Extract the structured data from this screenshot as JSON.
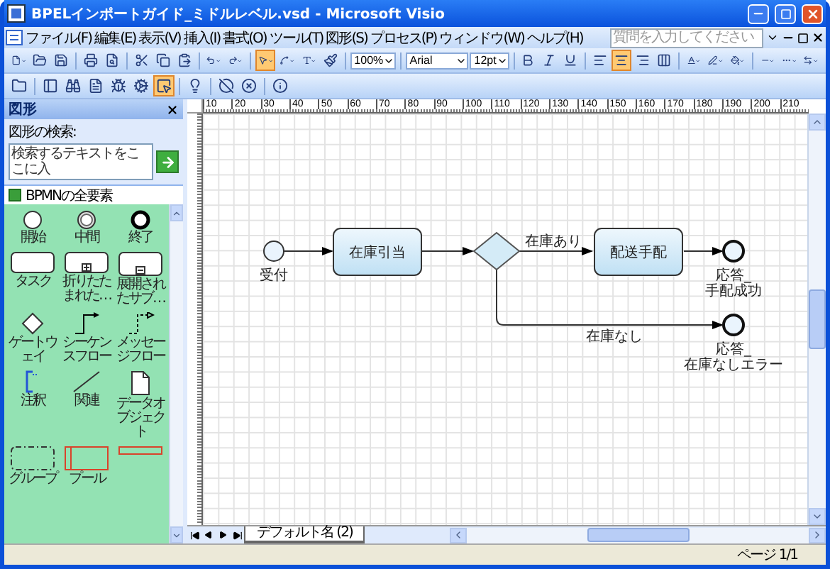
{
  "window": {
    "title": "BPELインポートガイド_ミドルレベル.vsd - Microsoft Visio"
  },
  "menu": [
    "ファイル(F)",
    "編集(E)",
    "表示(V)",
    "挿入(I)",
    "書式(O)",
    "ツール(T)",
    "図形(S)",
    "プロセス(P)",
    "ウィンドウ(W)",
    "ヘルプ(H)"
  ],
  "help_search": {
    "placeholder": "質問を入力してください"
  },
  "toolbars": [
    {
      "items": [
        {
          "kind": "new",
          "pressed": false
        },
        {
          "kind": "open",
          "pressed": false
        },
        {
          "kind": "save",
          "pressed": false
        },
        {
          "kind": "separator"
        },
        {
          "kind": "print",
          "pressed": false
        },
        {
          "kind": "preview",
          "pressed": false
        },
        {
          "kind": "separator"
        },
        {
          "kind": "cut",
          "pressed": false
        },
        {
          "kind": "copy",
          "pressed": false
        },
        {
          "kind": "paste",
          "pressed": false
        },
        {
          "kind": "separator"
        },
        {
          "kind": "undo",
          "pressed": false
        },
        {
          "kind": "redo",
          "pressed": false
        },
        {
          "kind": "separator"
        },
        {
          "kind": "pointer",
          "pressed": true
        },
        {
          "kind": "connector",
          "pressed": false
        },
        {
          "kind": "text",
          "pressed": false
        },
        {
          "kind": "format-painter",
          "pressed": false
        },
        {
          "kind": "separator"
        },
        {
          "kind": "zoom",
          "value": "100%"
        },
        {
          "kind": "separator"
        },
        {
          "kind": "font",
          "value": "Arial"
        },
        {
          "kind": "font-size",
          "value": "12pt"
        },
        {
          "kind": "separator"
        },
        {
          "kind": "bold",
          "pressed": false
        },
        {
          "kind": "italic",
          "pressed": false
        },
        {
          "kind": "underline",
          "pressed": false
        },
        {
          "kind": "separator"
        },
        {
          "kind": "align-left",
          "pressed": false
        },
        {
          "kind": "align-center",
          "pressed": true
        },
        {
          "kind": "align-right",
          "pressed": false
        },
        {
          "kind": "distribute",
          "pressed": false
        },
        {
          "kind": "separator"
        },
        {
          "kind": "font-color",
          "pressed": false
        },
        {
          "kind": "line-color",
          "pressed": false
        },
        {
          "kind": "fill-color",
          "pressed": false
        },
        {
          "kind": "separator"
        },
        {
          "kind": "line-weight",
          "pressed": false
        },
        {
          "kind": "line-pattern",
          "pressed": false
        },
        {
          "kind": "line-ends",
          "pressed": false
        }
      ]
    },
    {
      "items": [
        {
          "kind": "shapes",
          "pressed": false
        },
        {
          "kind": "separator"
        },
        {
          "kind": "layers",
          "pressed": false
        },
        {
          "kind": "find",
          "pressed": false
        },
        {
          "kind": "document",
          "pressed": false
        },
        {
          "kind": "debug",
          "pressed": false
        },
        {
          "kind": "add-ons",
          "pressed": false
        },
        {
          "kind": "select",
          "pressed": true
        },
        {
          "kind": "separator"
        },
        {
          "kind": "help",
          "pressed": false
        },
        {
          "kind": "separator"
        },
        {
          "kind": "stop",
          "pressed": false
        },
        {
          "kind": "cancel",
          "pressed": false
        },
        {
          "kind": "separator"
        },
        {
          "kind": "info",
          "pressed": false
        }
      ]
    }
  ],
  "shapes_panel": {
    "title": "図形",
    "search_label": "図形の検索:",
    "search_placeholder": "検索するテキストをここに入",
    "stencil": "BPMNの全要素",
    "items": [
      {
        "kind": "start-event",
        "label": "開始"
      },
      {
        "kind": "intermediate-event",
        "label": "中間"
      },
      {
        "kind": "end-event",
        "label": "終了"
      },
      {
        "kind": "task",
        "label": "タスク"
      },
      {
        "kind": "collapsed-subprocess",
        "label": "折りたたまれた…"
      },
      {
        "kind": "expanded-subprocess",
        "label": "展開されたサブ…"
      },
      {
        "kind": "gateway",
        "label": "ゲートウェイ"
      },
      {
        "kind": "sequence-flow",
        "label": "シーケンスフロー"
      },
      {
        "kind": "message-flow",
        "label": "メッセージフロー"
      },
      {
        "kind": "annotation",
        "label": "注釈"
      },
      {
        "kind": "association",
        "label": "関連"
      },
      {
        "kind": "data-object",
        "label": "データオブジェクト"
      },
      {
        "kind": "group",
        "label": "グループ"
      },
      {
        "kind": "pool",
        "label": "プール"
      },
      {
        "kind": "lane"
      }
    ]
  },
  "ruler_labels": [
    "10",
    "20",
    "30",
    "40",
    "50",
    "60",
    "70",
    "80",
    "90",
    "100",
    "110",
    "120",
    "130",
    "140",
    "150",
    "160",
    "170",
    "180",
    "190",
    "200",
    "210"
  ],
  "diagram": {
    "nodes": [
      {
        "kind": "start",
        "label_lines": [
          "受付"
        ]
      },
      {
        "kind": "task",
        "label_lines": [
          "在庫引当"
        ]
      },
      {
        "kind": "gateway"
      },
      {
        "kind": "task",
        "label_lines": [
          "配送手配"
        ]
      },
      {
        "kind": "end",
        "label_lines": [
          "応答_",
          "手配成功"
        ]
      },
      {
        "kind": "end",
        "label_lines": [
          "応答_",
          "在庫なしエラー"
        ]
      }
    ],
    "edges": [
      {
        "kind": "sequence"
      },
      {
        "kind": "sequence"
      },
      {
        "kind": "sequence",
        "label": "在庫あり"
      },
      {
        "kind": "sequence"
      },
      {
        "kind": "sequence",
        "label": "在庫なし"
      }
    ]
  },
  "page_tabs": [
    {
      "label": "デフォルト名 (2)",
      "selected": true
    }
  ],
  "status_bar": {
    "page": "ページ 1/1"
  }
}
